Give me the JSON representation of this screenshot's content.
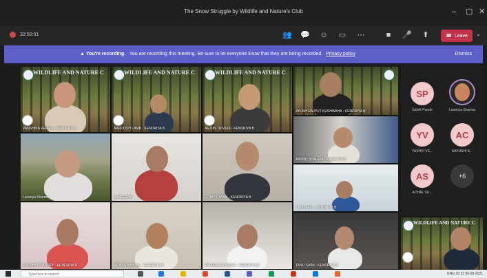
{
  "window": {
    "title": "The Snow Struggle by Wildlife and Nature's Club"
  },
  "toolbar": {
    "timer": "32:50:01",
    "leave_label": "Leave"
  },
  "banner": {
    "lead": "You're recording.",
    "text": "You are recording this meeting. Be sure to let everyone know that they are being recorded.",
    "link": "Privacy policy",
    "dismiss": "Dismiss"
  },
  "club_banner": "WILDLIFE AND NATURE C",
  "tiles": [
    {
      "name": "VANSHIKA VERMA - KENDRIYA B"
    },
    {
      "name": "AAROOSH LAMB - KENDRIYA B"
    },
    {
      "name": "ARJUN TRIVEDI - KENDRIYA B"
    },
    {
      "name": "AYUSH RAJPUT KUSHWAHA - KENDRIYA B"
    },
    {
      "name": "Lavanya Sharma"
    },
    {
      "name": "SANGEETA"
    },
    {
      "name": "ROHIT DIWAN - KENDRIYA B"
    },
    {
      "name": "ANSHU SHARMA - KENDRIYA B"
    },
    {
      "name": "YASH JAIN - KENDRIYA B"
    },
    {
      "name": "ANUSHKA PANDEY - KENDRIYA B"
    },
    {
      "name": "MEHAK BANSAL - KENDRIYA B"
    },
    {
      "name": "PRIYANKA KUMARI - KENDRIYA B"
    },
    {
      "name": "TANU SAINI - KENDRIYA B"
    }
  ],
  "side_avatars": [
    {
      "initials": "SP",
      "name": "Satvik Pande"
    },
    {
      "initials": "",
      "name": "Lavanya Sharma"
    },
    {
      "initials": "YV",
      "name": "YASHVI VE..."
    },
    {
      "initials": "AC",
      "name": "AAYUSHI A..."
    },
    {
      "initials": "AS",
      "name": "ACHAL SU..."
    }
  ],
  "more_count": "+6",
  "taskbar": {
    "search_placeholder": "Type here to search",
    "tray": "ENG  10:32  06-08-2021"
  }
}
